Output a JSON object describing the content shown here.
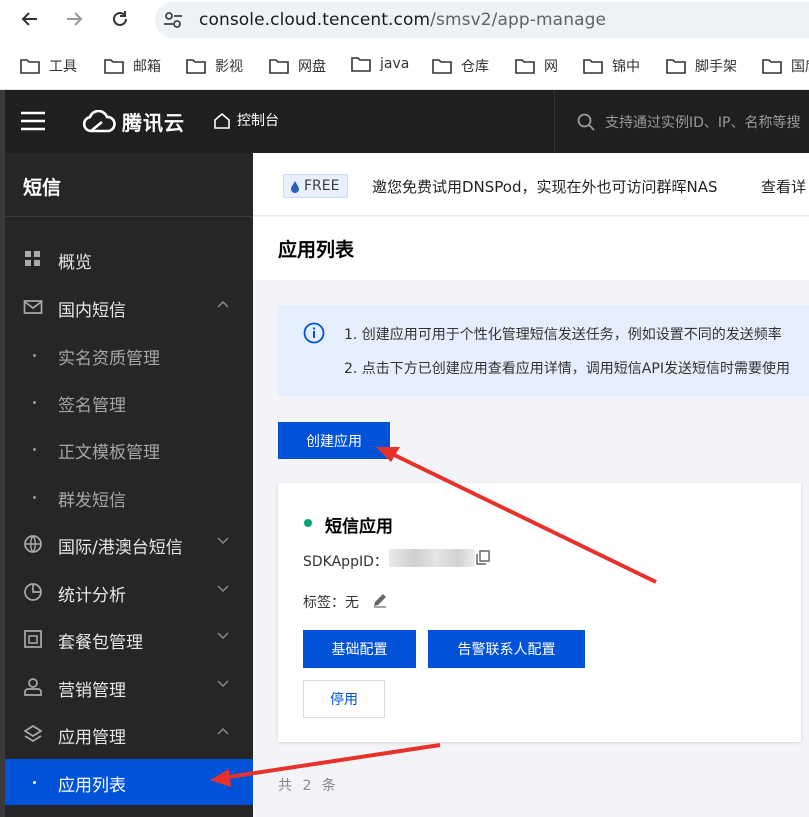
{
  "browser": {
    "url_host": "console.cloud.tencent.com",
    "url_path": "/smsv2/app-manage",
    "bookmarks": [
      "工具",
      "邮箱",
      "影视",
      "网盘",
      "java",
      "仓库",
      "网",
      "锦中",
      "脚手架",
      "国席"
    ]
  },
  "topbar": {
    "brand": "腾讯云",
    "console_label": "控制台",
    "search_placeholder": "支持通过实例ID、IP、名称等搜"
  },
  "sidebar": {
    "title": "短信",
    "items": [
      {
        "label": "概览",
        "icon": "grid-icon"
      },
      {
        "label": "国内短信",
        "icon": "mail-icon",
        "expanded": true
      },
      {
        "label": "实名资质管理"
      },
      {
        "label": "签名管理"
      },
      {
        "label": "正文模板管理"
      },
      {
        "label": "群发短信"
      },
      {
        "label": "国际/港澳台短信",
        "icon": "globe-icon",
        "expanded": false
      },
      {
        "label": "统计分析",
        "icon": "pie-chart-icon",
        "expanded": false
      },
      {
        "label": "套餐包管理",
        "icon": "package-icon",
        "expanded": false
      },
      {
        "label": "营销管理",
        "icon": "user-icon",
        "expanded": false
      },
      {
        "label": "应用管理",
        "icon": "layers-icon",
        "expanded": true
      },
      {
        "label": "应用列表",
        "active": true
      }
    ]
  },
  "promo": {
    "badge": "FREE",
    "text": "邀您免费试用DNSPod，实现在外也可访问群晖NAS",
    "more": "查看详"
  },
  "page": {
    "title": "应用列表",
    "notice_lines": [
      "1. 创建应用可用于个性化管理短信发送任务，例如设置不同的发送频率",
      "2. 点击下方已创建应用查看应用详情，调用短信API发送短信时需要使用"
    ],
    "create_button": "创建应用",
    "total": "共 2 条"
  },
  "app_card": {
    "name": "短信应用",
    "status_color": "#00a870",
    "sdk_label": "SDKAppID：",
    "tag_label": "标签：无",
    "config_button": "基础配置",
    "alert_button": "告警联系人配置",
    "disable_button": "停用"
  },
  "colors": {
    "primary": "#0052d9",
    "sidebar_bg": "#262626",
    "topbar_bg": "#1f1f1f",
    "annotation_red": "#e8312a"
  }
}
